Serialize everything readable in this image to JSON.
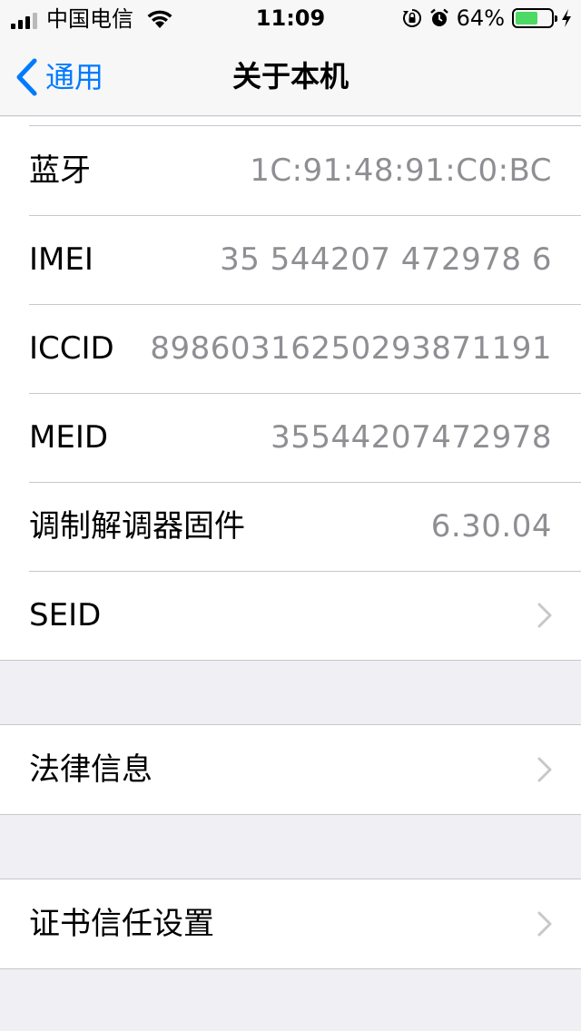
{
  "status_bar": {
    "carrier": "中国电信",
    "time": "11:09",
    "battery_percent": "64%",
    "battery_level": 0.64
  },
  "nav": {
    "back_label": "通用",
    "title": "关于本机"
  },
  "device_info": [
    {
      "label": "蓝牙",
      "value": "1C:91:48:91:C0:BC"
    },
    {
      "label": "IMEI",
      "value": "35 544207 472978 6"
    },
    {
      "label": "ICCID",
      "value": "89860316250293871191"
    },
    {
      "label": "MEID",
      "value": "35544207472978"
    },
    {
      "label": "调制解调器固件",
      "value": "6.30.04"
    },
    {
      "label": "SEID",
      "value": ""
    }
  ],
  "legal": {
    "label": "法律信息"
  },
  "cert": {
    "label": "证书信任设置"
  },
  "colors": {
    "accent": "#007aff",
    "background": "#efeff4",
    "secondary_text": "#8e8e93",
    "battery_fill": "#4cd964"
  }
}
